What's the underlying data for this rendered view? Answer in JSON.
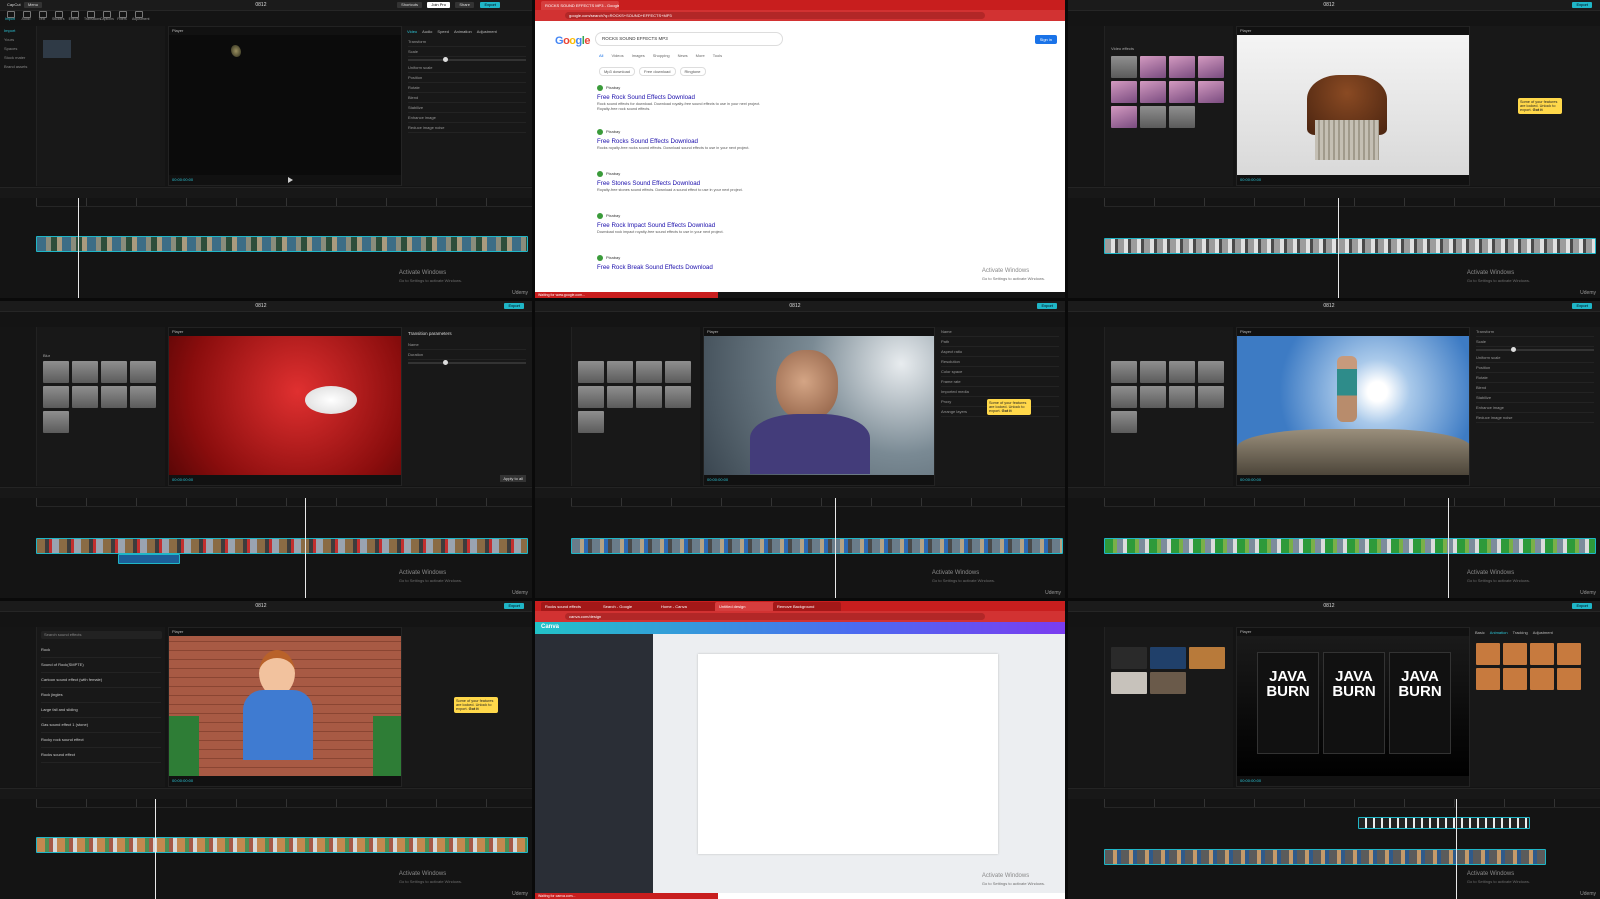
{
  "common": {
    "app_name": "CapCut",
    "menu_label": "Menu",
    "title": "0812",
    "shortcuts_label": "Shortcuts",
    "join_pro_label": "Join Pro",
    "share_label": "Share",
    "export_label": "Export",
    "tools": [
      "Import",
      "Audio",
      "Text",
      "Stickers",
      "Effects",
      "Transitions",
      "Captions",
      "Filters",
      "Adjustment"
    ],
    "player_label": "Player",
    "timecode": "00:00:00:00",
    "watermark_title": "Activate Windows",
    "watermark_sub": "Go to Settings to activate Windows.",
    "credit": "Udemy",
    "accent_color": "#1fb6c7"
  },
  "tile_editor_1": {
    "props_tabs": [
      "Video",
      "Audio",
      "Speed",
      "Animation",
      "Adjustment"
    ],
    "rows": [
      "Transform",
      "Scale",
      "Uniform scale",
      "Position",
      "Rotate",
      "Blend",
      "Stabilize",
      "Enhance image",
      "Reduce image noise"
    ],
    "media_sidebar": [
      "Import",
      "Yours",
      "Spaces",
      "Stock mater",
      "Brand assets"
    ]
  },
  "tile_browser": {
    "tab_title": "ROCKS SOUND EFFECTS MP3 - Google Search",
    "url": "google.com/search?q=ROCKS+SOUND+EFFECTS+MP3",
    "search_query": "ROCKS SOUND EFFECTS MP3",
    "search_tabs": [
      "All",
      "Videos",
      "Images",
      "Shopping",
      "News",
      "More",
      "Tools"
    ],
    "chips": [
      "Mp3 download",
      "Free download",
      "Ringtone"
    ],
    "sign_in": "Sign in",
    "status_text": "Waiting for www.google.com...",
    "results": [
      {
        "source": "Pixabay",
        "title": "Free Rock Sound Effects Download",
        "desc": "Rock sound effects for download. Download royalty-free sound effects to use in your next project. Royalty-free rock sound effects."
      },
      {
        "source": "Pixabay",
        "title": "Free Rocks Sound Effects Download",
        "desc": "Rocks royalty-free rocks sound effects. Download sound effects to use in your next project."
      },
      {
        "source": "Pixabay",
        "title": "Free Stones Sound Effects Download",
        "desc": "Royalty-free stones sound effects. Download a sound effect to use in your next project."
      },
      {
        "source": "Pixabay",
        "title": "Free Rock Impact Sound Effects Download",
        "desc": "Download rock impact royalty-free sound effects to use in your next project."
      },
      {
        "source": "Pixabay",
        "title": "Free Rock Break Sound Effects Download",
        "desc": "Download rock break royalty-free sound effects to use in your next project."
      }
    ]
  },
  "tile_editor_3": {
    "section": "Video effects",
    "tooltip": "Some of your features are locked. Unlock to export.",
    "tooltip_btn": "Got it"
  },
  "tile_transitions": {
    "panel_title": "Transition parameters",
    "rows": [
      "Name",
      "Duration"
    ],
    "apply_label": "Apply to all",
    "section": "Blur"
  },
  "tile_editor_5": {
    "tooltip": "Some of your features are locked. Unlock to export.",
    "tooltip_btn": "Got it",
    "detail_rows": [
      "Name",
      "Path",
      "Aspect ratio",
      "Resolution",
      "Color space",
      "Frame rate",
      "Imported media",
      "Proxy",
      "Arrange layers"
    ]
  },
  "tile_editor_6": {
    "rows": [
      "Transform",
      "Scale",
      "Uniform scale",
      "Position",
      "Rotate",
      "Blend",
      "Stabilize",
      "Enhance image",
      "Reduce image noise"
    ]
  },
  "tile_audio": {
    "search_placeholder": "Search sound effects",
    "sound_items": [
      "Rock",
      "Sound of Rock(SMPTE)",
      "Cartoon sound effect (with female)",
      "Rock jingles",
      "Large fall and sliding",
      "Gas sound effect 1 (stone)",
      "Rocky rock sound effect",
      "Rocks sound effect"
    ],
    "tooltip": "Some of your features are locked. Unlock to export.",
    "tooltip_btn": "Got it"
  },
  "tile_canva": {
    "tabs": [
      "Rocks sound effects",
      "Search - Google",
      "Home - Canva",
      "Untitled design",
      "Remove Background"
    ],
    "url": "canva.com/design",
    "logo": "Canva",
    "status_text": "Waiting for canva.com..."
  },
  "tile_java": {
    "props_tabs": [
      "Basic",
      "Animation",
      "Tracking",
      "Adjustment"
    ],
    "product_text": [
      "JAVA",
      "BURN"
    ]
  }
}
